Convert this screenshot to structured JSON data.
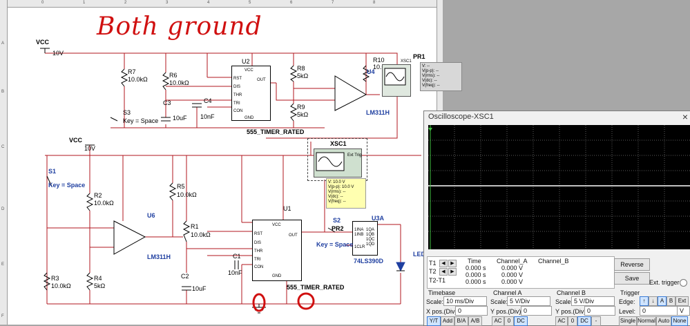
{
  "annotations": {
    "headline": "Both ground",
    "circle_left": "0",
    "circle_right": "0"
  },
  "ruler": {
    "top": [
      "0",
      "1",
      "2",
      "3",
      "4",
      "5",
      "6",
      "7",
      "8"
    ],
    "left": [
      "A",
      "B",
      "C",
      "D",
      "E",
      "F"
    ]
  },
  "schematic": {
    "vcc_top": {
      "name": "VCC",
      "value": "10V"
    },
    "vcc_left": {
      "name": "VCC",
      "value": "10V"
    },
    "u2": {
      "ref": "U2",
      "part": "555_TIMER_RATED",
      "pins_left": [
        "RST",
        "DIS",
        "THR",
        "TRI",
        "CON"
      ],
      "pin_top": "VCC",
      "pin_right": "OUT",
      "pin_bottom": "GND"
    },
    "u1": {
      "ref": "U1",
      "part": "555_TIMER_RATED",
      "pins_left": [
        "RST",
        "DIS",
        "THR",
        "TRI",
        "CON"
      ],
      "pin_top": "VCC",
      "pin_right": "OUT",
      "pin_bottom": "GND"
    },
    "u4": {
      "ref": "U4",
      "part": "LM311H"
    },
    "u6": {
      "ref": "U6",
      "part": "LM311H"
    },
    "u3a": {
      "ref": "U3A",
      "part": "74LS390D",
      "pins_left": [
        "1INA",
        "1INB",
        "1CLR"
      ],
      "pins_right": [
        "1QA",
        "1QB",
        "1QC",
        "1QD"
      ]
    },
    "r7": {
      "ref": "R7",
      "value": "10.0kΩ"
    },
    "r6": {
      "ref": "R6",
      "value": "10.0kΩ"
    },
    "r8": {
      "ref": "R8",
      "value": "5kΩ"
    },
    "r9": {
      "ref": "R9",
      "value": "5kΩ"
    },
    "r10": {
      "ref": "R10",
      "value": "10.0kΩ"
    },
    "r2": {
      "ref": "R2",
      "value": "10.0kΩ"
    },
    "r3": {
      "ref": "R3",
      "value": "10.0kΩ"
    },
    "r4": {
      "ref": "R4",
      "value": "5kΩ"
    },
    "r5": {
      "ref": "R5",
      "value": "10.0kΩ"
    },
    "r1": {
      "ref": "R1",
      "value": "10.0kΩ"
    },
    "c3": {
      "ref": "C3",
      "value": "10uF"
    },
    "c4": {
      "ref": "C4",
      "value": "10nF"
    },
    "c1": {
      "ref": "C1",
      "value": "10nF"
    },
    "c2": {
      "ref": "C2",
      "value": "10uF"
    },
    "s3": {
      "ref": "S3",
      "key": "Key = Space"
    },
    "s1": {
      "ref": "S1",
      "key": "Key = Space"
    },
    "s2": {
      "ref": "S2",
      "key": "Key = Space"
    },
    "pr1": {
      "ref": "PR1"
    },
    "pr2": {
      "ref": "PR2"
    },
    "xsc1": {
      "ref": "XSC1",
      "ext_trig": "Ext Trig"
    },
    "xsc1_top": {
      "ref": "XSC1"
    },
    "led": {
      "ref": "LED"
    },
    "probe_gray": [
      "V: --",
      "V(p-p): --",
      "V(rms): --",
      "V(dc): --",
      "V(freq): --"
    ],
    "probe_yellow": [
      "V: 10.0 V",
      "V(p-p): 10.0 V",
      "V(rms): --",
      "V(dc): --",
      "V(freq): --"
    ]
  },
  "oscilloscope": {
    "title": "Oscilloscope-XSC1",
    "close": "×",
    "readout": {
      "headers": [
        "Time",
        "Channel_A",
        "Channel_B"
      ],
      "rows": [
        {
          "label": "T1",
          "time": "0.000 s",
          "a": "0.000 V",
          "b": ""
        },
        {
          "label": "T2",
          "time": "0.000 s",
          "a": "0.000 V",
          "b": ""
        },
        {
          "label": "T2-T1",
          "time": "0.000 s",
          "a": "0.000 V",
          "b": ""
        }
      ]
    },
    "buttons": {
      "reverse": "Reverse",
      "save": "Save",
      "ext_trigger": "Ext. trigger"
    },
    "timebase": {
      "title": "Timebase",
      "scale_label": "Scale:",
      "scale": "10 ms/Div",
      "xpos_label": "X pos.(Div):",
      "xpos": "0",
      "modes": [
        "Y/T",
        "Add",
        "B/A",
        "A/B"
      ]
    },
    "channel_a": {
      "title": "Channel A",
      "scale_label": "Scale:",
      "scale": "5 V/Div",
      "ypos_label": "Y pos.(Div):",
      "ypos": "0",
      "coupling": [
        "AC",
        "0",
        "DC"
      ]
    },
    "channel_b": {
      "title": "Channel B",
      "scale_label": "Scale:",
      "scale": "5 V/Div",
      "ypos_label": "Y pos.(Div):",
      "ypos": "0",
      "coupling": [
        "AC",
        "0",
        "DC",
        "-"
      ]
    },
    "trigger": {
      "title": "Trigger",
      "edge_label": "Edge:",
      "edges": [
        "↑",
        "↓",
        "A",
        "B",
        "Ext"
      ],
      "level_label": "Level:",
      "level": "0",
      "level_unit": "V",
      "modes": [
        "Single",
        "Normal",
        "Auto",
        "None"
      ]
    }
  },
  "colors": {
    "wire": "#b0141e",
    "trace": "#ffffff",
    "handwriting": "#d01010",
    "blue_label": "#1f3fa0"
  }
}
